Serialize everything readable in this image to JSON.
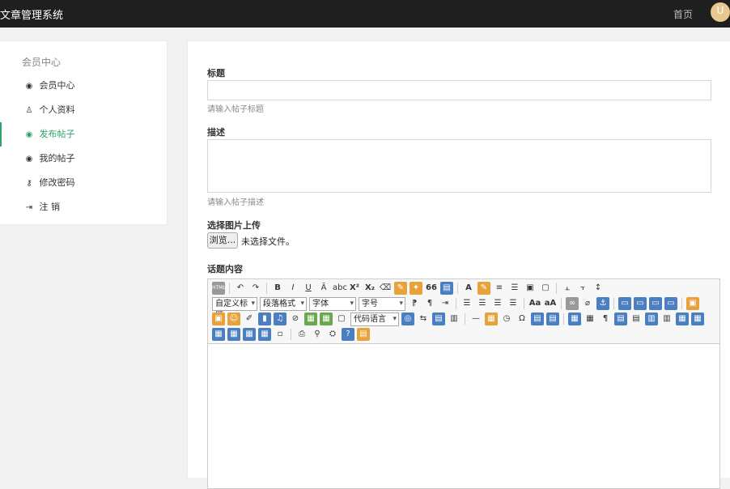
{
  "header": {
    "title": "文章管理系统",
    "home_label": "首页",
    "avatar_initial": "U"
  },
  "sidebar": {
    "heading": "会员中心",
    "items": [
      {
        "label": "会员中心",
        "icon": "user-circle-icon"
      },
      {
        "label": "个人资料",
        "icon": "person-icon"
      },
      {
        "label": "发布帖子",
        "icon": "publish-icon"
      },
      {
        "label": "我的帖子",
        "icon": "posts-icon"
      },
      {
        "label": "修改密码",
        "icon": "key-icon"
      },
      {
        "label": "注 销",
        "icon": "logout-icon"
      }
    ],
    "active": "发布帖子",
    "accent": "#2ba36a"
  },
  "form": {
    "title_label": "标题",
    "title_value": "",
    "title_hint": "请输入帖子标题",
    "desc_label": "描述",
    "desc_value": "",
    "desc_hint": "请输入帖子描述",
    "image_label": "选择图片上传",
    "browse_label": "浏览...",
    "no_file_text": "未选择文件。",
    "content_label": "话题内容"
  },
  "editor": {
    "font_selects": {
      "custom_title": "自定义标题",
      "paragraph_format": "段落格式",
      "font_family": "字体",
      "font_size": "字号",
      "code_language": "代码语言"
    },
    "toolbar_text_buttons": {
      "html": "HTML",
      "bold": "B",
      "italic": "I",
      "underline": "U",
      "quote": "66",
      "font_color": "A",
      "superscript": "X²",
      "subscript": "X₂"
    }
  }
}
